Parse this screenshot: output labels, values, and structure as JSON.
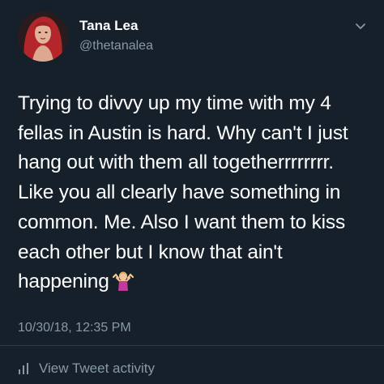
{
  "author": {
    "name": "Tana Lea",
    "handle": "@thetanalea",
    "avatar_icon": "profile-photo"
  },
  "tweet": {
    "lines": [
      "Trying to divvy up my time with my 4",
      "fellas in Austin is hard. Why can't I just",
      "hang out with them all togetherrrrrrrr.",
      "Like you all clearly have something in",
      "common. Me. Also I want them to kiss",
      "each other but I know that ain't",
      "happening"
    ],
    "emoji": "person-shrugging-emoji",
    "timestamp": "10/30/18, 12:35 PM"
  },
  "footer": {
    "activity_label": "View Tweet activity",
    "activity_icon": "bar-chart-icon"
  },
  "colors": {
    "background": "#15202b",
    "primary_text": "#ffffff",
    "secondary_text": "#8899a6",
    "divider": "#2c3a47"
  }
}
